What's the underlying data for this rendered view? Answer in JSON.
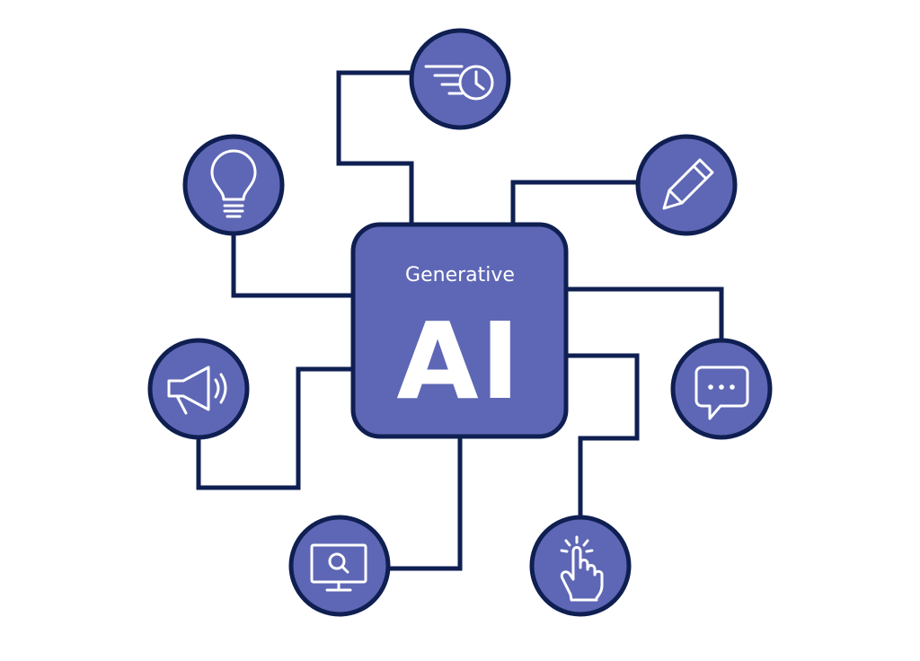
{
  "hub": {
    "subtitle": "Generative",
    "title": "AI"
  },
  "nodes": [
    {
      "icon": "fast-clock-icon"
    },
    {
      "icon": "lightbulb-icon"
    },
    {
      "icon": "pencil-icon"
    },
    {
      "icon": "megaphone-icon"
    },
    {
      "icon": "chat-bubble-icon"
    },
    {
      "icon": "monitor-search-icon"
    },
    {
      "icon": "tap-hand-icon"
    }
  ],
  "colors": {
    "fill": "#5e67b5",
    "stroke": "#0f1f52",
    "text": "#ffffff",
    "background": "#ffffff"
  }
}
